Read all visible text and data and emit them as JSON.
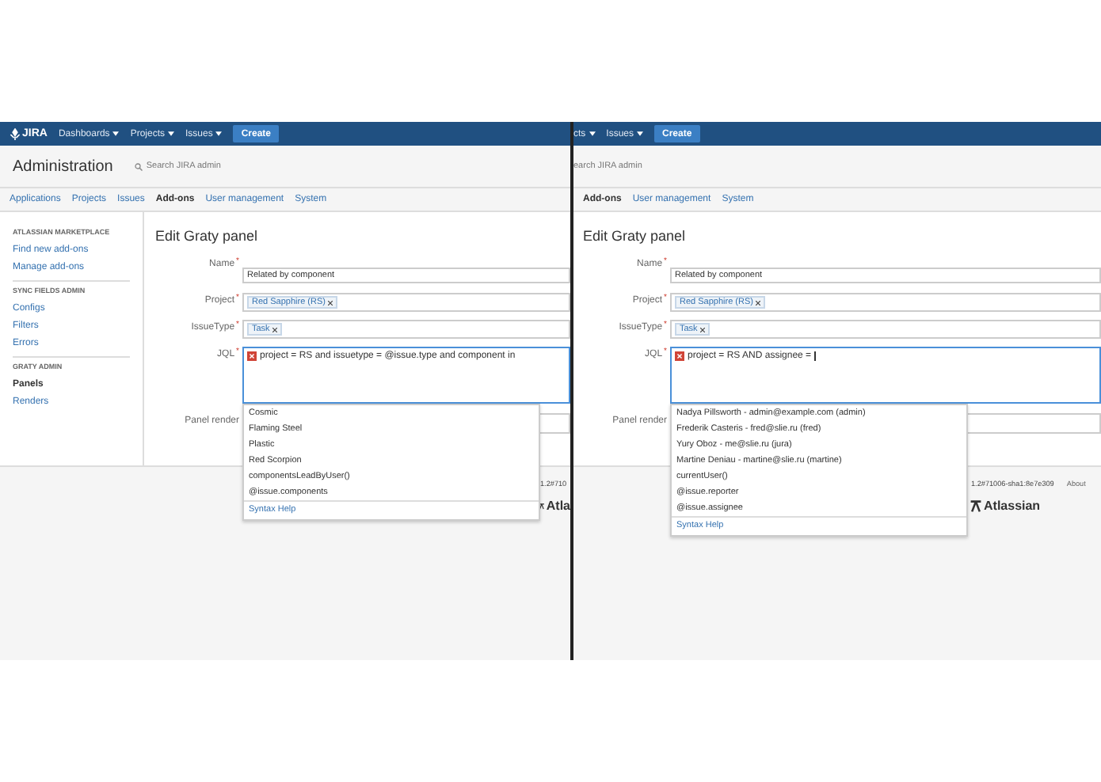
{
  "panels": [
    {
      "header": {
        "logo": "JIRA",
        "menus": [
          "Dashboards",
          "Projects",
          "Issues"
        ],
        "create": "Create"
      },
      "admin": {
        "title": "Administration",
        "search_placeholder": "Search JIRA admin",
        "search_icon": true
      },
      "tabs": [
        {
          "label": "Applications",
          "selected": false
        },
        {
          "label": "Projects",
          "selected": false
        },
        {
          "label": "Issues",
          "selected": false
        },
        {
          "label": "Add-ons",
          "selected": true
        },
        {
          "label": "User management",
          "selected": false
        },
        {
          "label": "System",
          "selected": false
        }
      ],
      "sidebar": [
        {
          "heading": "ATLASSIAN MARKETPLACE",
          "items": [
            {
              "label": "Find new add-ons",
              "selected": false
            },
            {
              "label": "Manage add-ons",
              "selected": false
            }
          ]
        },
        {
          "heading": "SYNC FIELDS ADMIN",
          "items": [
            {
              "label": "Configs",
              "selected": false
            },
            {
              "label": "Filters",
              "selected": false
            },
            {
              "label": "Errors",
              "selected": false
            }
          ]
        },
        {
          "heading": "GRATY ADMIN",
          "items": [
            {
              "label": "Panels",
              "selected": true
            },
            {
              "label": "Renders",
              "selected": false
            }
          ]
        }
      ],
      "page_title": "Edit Graty panel",
      "fields": [
        {
          "label": "Name",
          "required_mark": "*",
          "kind": "text",
          "value": "Related by component"
        },
        {
          "label": "Project",
          "required_mark": "*",
          "kind": "tags",
          "tags": [
            "Red Sapphire (RS)"
          ]
        },
        {
          "label": "IssueType",
          "required_mark": "*",
          "kind": "tags",
          "tags": [
            "Task"
          ]
        },
        {
          "label": "JQL",
          "required_mark": "*",
          "kind": "jql",
          "value": "project = RS and issuetype = @issue.type and component in",
          "error": true,
          "caret": false
        },
        {
          "label": "Panel render",
          "kind": "select"
        }
      ],
      "suggestions": [
        "Cosmic",
        "Flaming Steel",
        "Plastic",
        "Red Scorpion",
        "componentsLeadByUser()",
        "@issue.components"
      ],
      "syntax_help": "Syntax Help",
      "footer": {
        "version": "1.2#710",
        "logo": "Atla"
      }
    },
    {
      "header": {
        "menus": [
          "cts",
          "Issues"
        ],
        "create": "Create"
      },
      "admin": {
        "search_placeholder": "earch JIRA admin",
        "search_icon": false
      },
      "tabs": [
        {
          "label": "Add-ons",
          "selected": true
        },
        {
          "label": "User management",
          "selected": false
        },
        {
          "label": "System",
          "selected": false
        }
      ],
      "page_title": "Edit Graty panel",
      "fields": [
        {
          "label": "Name",
          "required_mark": "*",
          "kind": "text",
          "value": "Related by component"
        },
        {
          "label": "Project",
          "required_mark": "*",
          "kind": "tags",
          "tags": [
            "Red Sapphire (RS)"
          ]
        },
        {
          "label": "IssueType",
          "required_mark": "*",
          "kind": "tags",
          "tags": [
            "Task"
          ]
        },
        {
          "label": "JQL",
          "required_mark": "*",
          "kind": "jql",
          "value": "project = RS AND assignee =",
          "error": true,
          "caret": true
        },
        {
          "label": "Panel render",
          "kind": "select"
        }
      ],
      "suggestions": [
        "Nadya Pillsworth - admin@example.com (admin)",
        "Frederik Casteris - fred@slie.ru (fred)",
        "Yury Oboz - me@slie.ru (jura)",
        "Martine Deniau - martine@slie.ru (martine)",
        "currentUser()",
        "@issue.reporter",
        "@issue.assignee"
      ],
      "syntax_help": "Syntax Help",
      "footer": {
        "version": "1.2#71006-sha1:8e7e309",
        "about": "About",
        "logo": "Atlassian"
      }
    }
  ]
}
